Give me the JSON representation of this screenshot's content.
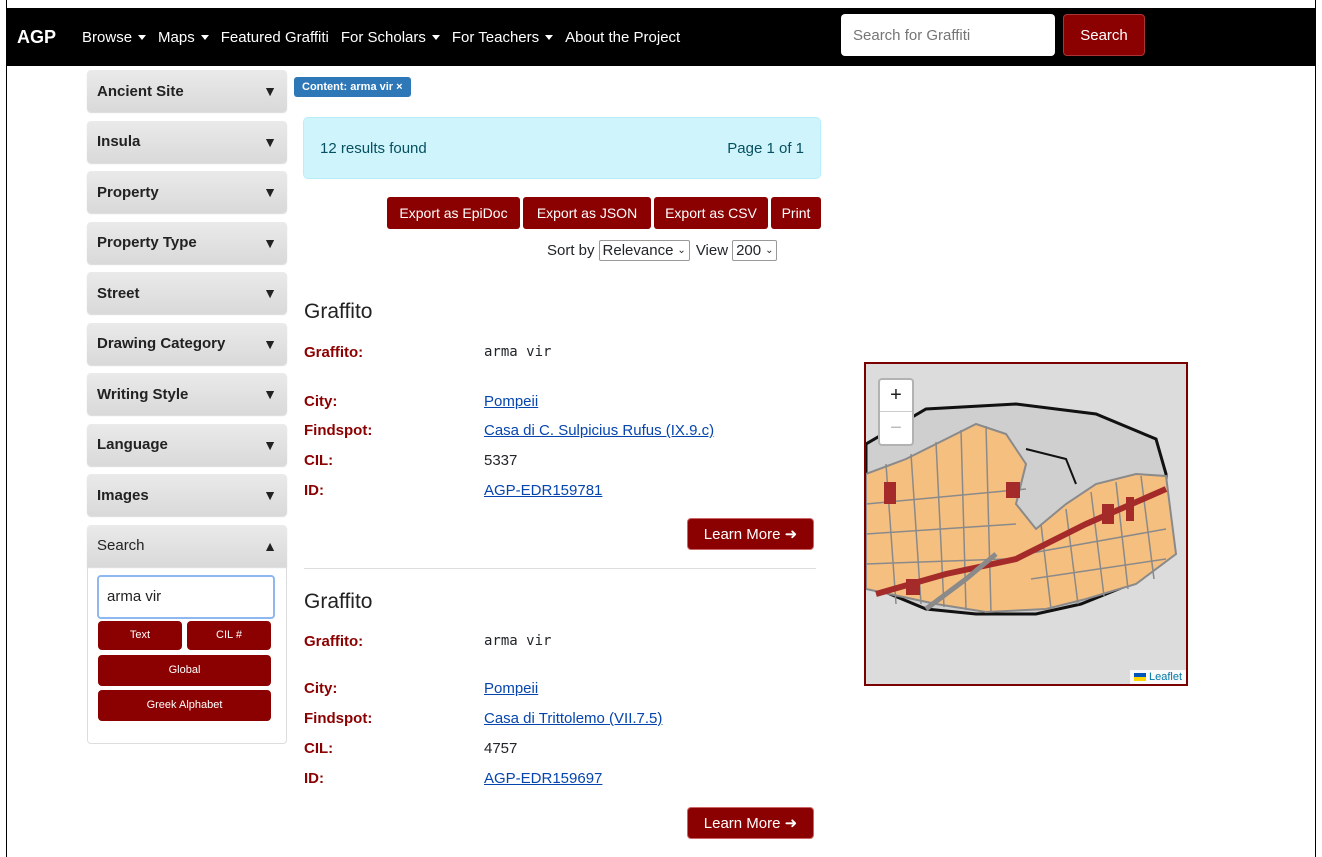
{
  "nav": {
    "brand": "AGP",
    "items": [
      {
        "label": "Browse",
        "dropdown": true
      },
      {
        "label": "Maps",
        "dropdown": true
      },
      {
        "label": "Featured Graffiti",
        "dropdown": false
      },
      {
        "label": "For Scholars",
        "dropdown": true
      },
      {
        "label": "For Teachers",
        "dropdown": true
      },
      {
        "label": "About the Project",
        "dropdown": false
      }
    ],
    "search_placeholder": "Search for Graffiti",
    "search_button": "Search"
  },
  "sidebar": {
    "filters": [
      "Ancient Site",
      "Insula",
      "Property",
      "Property Type",
      "Street",
      "Drawing Category",
      "Writing Style",
      "Language",
      "Images"
    ],
    "collapsed_glyph": "▼",
    "search_label": "Search",
    "expanded_glyph": "▲",
    "search_value": "arma vir",
    "buttons": {
      "text": "Text",
      "cil": "CIL #",
      "global": "Global",
      "greek": "Greek Alphabet"
    }
  },
  "active_filter": "Content: arma vir ×",
  "results": {
    "count_text": "12 results found",
    "page_text": "Page 1 of 1"
  },
  "export": {
    "epidoc": "Export as EpiDoc",
    "json": "Export as JSON",
    "csv": "Export as CSV",
    "print": "Print"
  },
  "sort": {
    "label": "Sort by",
    "value": "Relevance",
    "view_label": "View",
    "view_value": "200"
  },
  "labels": {
    "graffito": "Graffito:",
    "city": "City:",
    "findspot": "Findspot:",
    "cil": "CIL:",
    "id": "ID:",
    "learn_more": "Learn More ➜"
  },
  "entries": [
    {
      "title": "Graffito",
      "graffito": "arma vir",
      "city": "Pompeii",
      "findspot": "Casa di C. Sulpicius Rufus (IX.9.c)",
      "cil": "5337",
      "id": "AGP-EDR159781"
    },
    {
      "title": "Graffito",
      "graffito": "arma vir",
      "city": "Pompeii",
      "findspot": "Casa di Trittolemo (VII.7.5)",
      "cil": "4757",
      "id": "AGP-EDR159697"
    }
  ],
  "map": {
    "zoom_in": "+",
    "zoom_out": "−",
    "attribution": "Leaflet",
    "colors": {
      "land": "#f5bf80",
      "highlight": "#a52a2a",
      "streets": "#8a8a8a",
      "background": "#dcdcdc",
      "walls": "#111111"
    }
  }
}
